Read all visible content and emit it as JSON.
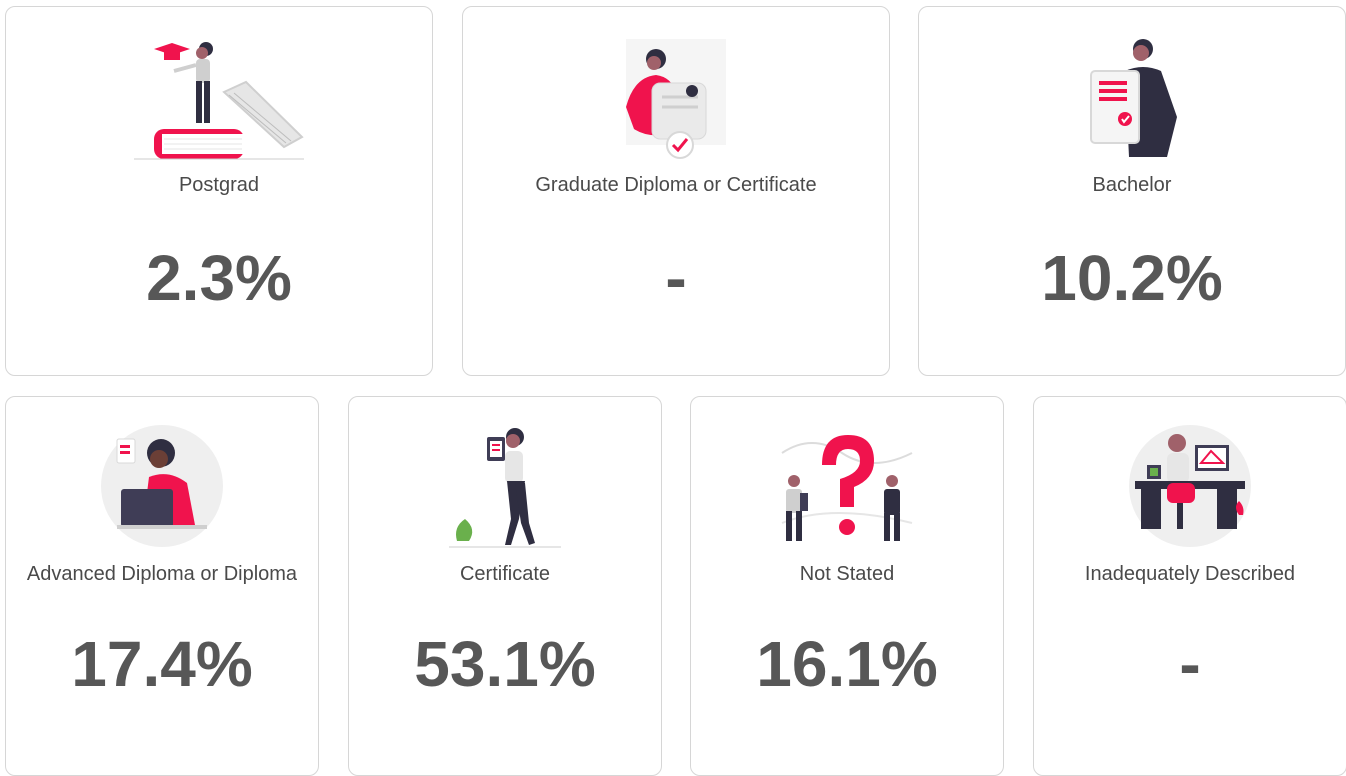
{
  "cards": [
    {
      "label": "Postgrad",
      "value": "2.3%",
      "illustration": "graduate-on-books-illustration"
    },
    {
      "label": "Graduate Diploma or Certificate",
      "value": "-",
      "illustration": "woman-holding-certificate-illustration"
    },
    {
      "label": "Bachelor",
      "value": "10.2%",
      "illustration": "man-with-diploma-illustration"
    },
    {
      "label": "Advanced Diploma or Diploma",
      "value": "17.4%",
      "illustration": "woman-at-laptop-illustration"
    },
    {
      "label": "Certificate",
      "value": "53.1%",
      "illustration": "woman-holding-tablet-illustration"
    },
    {
      "label": "Not Stated",
      "value": "16.1%",
      "illustration": "question-mark-people-illustration"
    },
    {
      "label": "Inadequately Described",
      "value": "-",
      "illustration": "person-at-desk-illustration"
    }
  ],
  "colors": {
    "accent": "#f0134d",
    "dark": "#2f2e41",
    "value_text": "#575757",
    "label_text": "#4a4a4a",
    "border": "#d6d6d6"
  }
}
